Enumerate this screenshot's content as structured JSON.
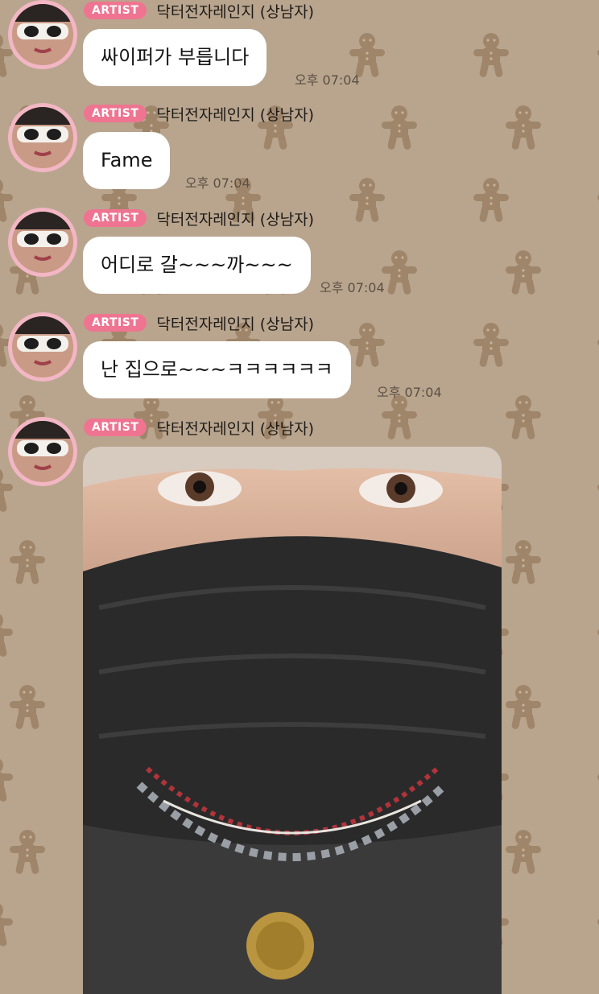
{
  "badge_label": "ARTIST",
  "sender_name": "닥터전자레인지 (상남자)",
  "messages": [
    {
      "text": "싸이퍼가 부릅니다",
      "time": "오후 07:04"
    },
    {
      "text": "Fame",
      "time": "오후 07:04"
    },
    {
      "text": "어디로 갈~~~까~~~",
      "time": "오후 07:04"
    },
    {
      "text": "난 집으로~~~ㅋㅋㅋㅋㅋㅋ",
      "time": "오후 07:04"
    }
  ],
  "colors": {
    "background": "#b9a58e",
    "badge": "#ef7491",
    "bubble": "#ffffff",
    "avatar_ring": "#f2b6c4"
  },
  "icons": {
    "background_pattern": "gingerbread-man-icon"
  }
}
